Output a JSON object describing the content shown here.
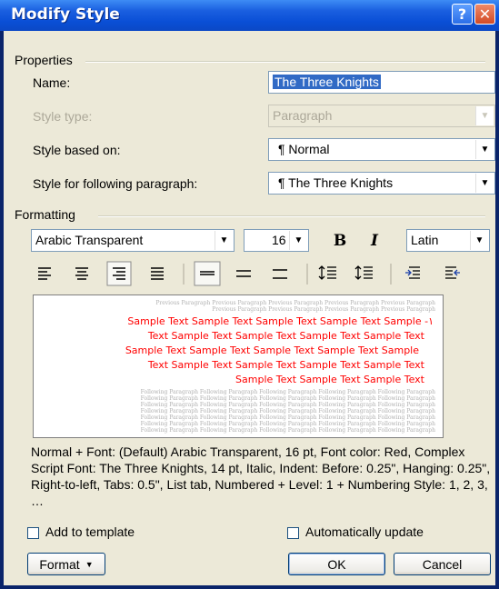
{
  "window": {
    "title": "Modify Style",
    "help_label": "?",
    "close_label": "✕"
  },
  "properties": {
    "group_label": "Properties",
    "name_label": "Name:",
    "name_value": "The Three Knights",
    "style_type_label": "Style type:",
    "style_type_value": "Paragraph",
    "based_on_label": "Style based on:",
    "based_on_value": "¶ Normal",
    "following_label": "Style for following paragraph:",
    "following_value": "¶ The Three Knights"
  },
  "formatting": {
    "group_label": "Formatting",
    "font_value": "Arabic Transparent",
    "size_value": "16",
    "bold_label": "B",
    "italic_label": "I",
    "script_value": "Latin"
  },
  "preview": {
    "previous_text": "Previous Paragraph Previous Paragraph Previous Paragraph Previous Paragraph Previous Paragraph",
    "previous_text_2": "Previous Paragraph Previous Paragraph Previous Paragraph Previous Paragraph",
    "sample_lines": [
      "Sample Text Sample Text Sample Text Sample Text Sample -١",
      "Text Sample Text Sample Text Sample Text Sample Text",
      "Sample Text Sample Text Sample Text Sample Text Sample",
      "Text Sample Text Sample Text Sample Text Sample Text",
      "Sample Text Sample Text Sample Text"
    ],
    "following_text": "Following Paragraph Following Paragraph Following Paragraph Following Paragraph Following Paragraph"
  },
  "description": "Normal + Font: (Default) Arabic Transparent, 16 pt, Font color: Red, Complex Script Font: The Three Knights, 14 pt, Italic, Indent: Before: 0.25\", Hanging: 0.25\", Right-to-left, Tabs: 0.5\", List tab, Numbered + Level: 1 + Numbering Style: 1, 2, 3, …",
  "options": {
    "add_to_template": "Add to template",
    "auto_update": "Automatically update"
  },
  "buttons": {
    "format": "Format",
    "ok": "OK",
    "cancel": "Cancel"
  },
  "colors": {
    "titlebar": "#0a4fd6",
    "dialog_bg": "#ece9d8",
    "preview_sample": "#ff0000",
    "selection": "#316ac5"
  }
}
